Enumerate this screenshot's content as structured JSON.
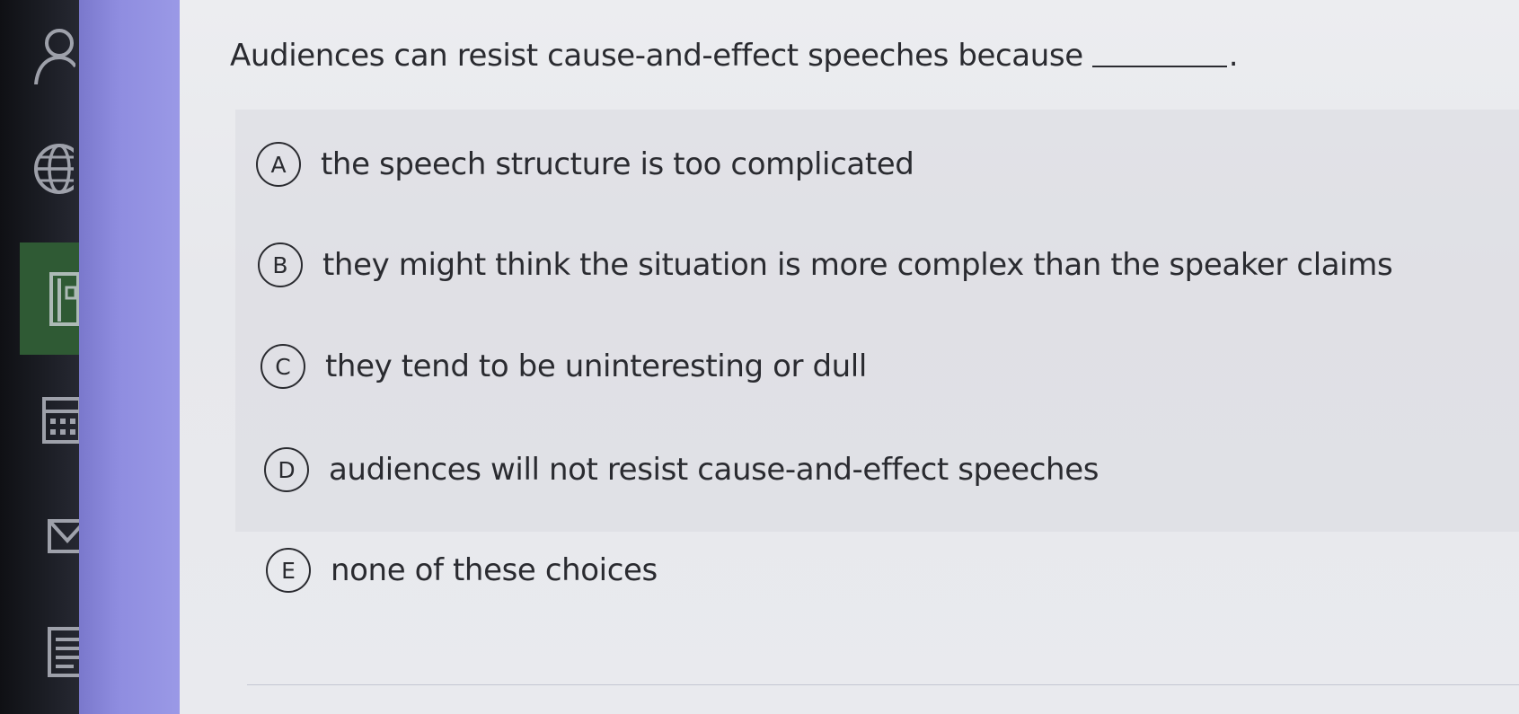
{
  "question": {
    "text": "Audiences can resist cause-and-effect speeches because",
    "suffix": "."
  },
  "options": [
    {
      "letter": "A",
      "text": "the speech structure is too complicated"
    },
    {
      "letter": "B",
      "text": "they might think the situation is more complex than the speaker claims"
    },
    {
      "letter": "C",
      "text": "they tend to be uninteresting or dull"
    },
    {
      "letter": "D",
      "text": "audiences will not resist cause-and-effect speeches"
    },
    {
      "letter": "E",
      "text": "none of these choices"
    }
  ],
  "sidebar_icons": [
    "user-icon",
    "globe-icon",
    "book-icon",
    "calendar-icon",
    "mail-icon",
    "document-icon"
  ],
  "colors": {
    "rail": "#1b1d24",
    "accent": "#8f8de0",
    "active_item": "#2f5a34",
    "panel": "#eaebee",
    "text": "#2a2b30"
  }
}
